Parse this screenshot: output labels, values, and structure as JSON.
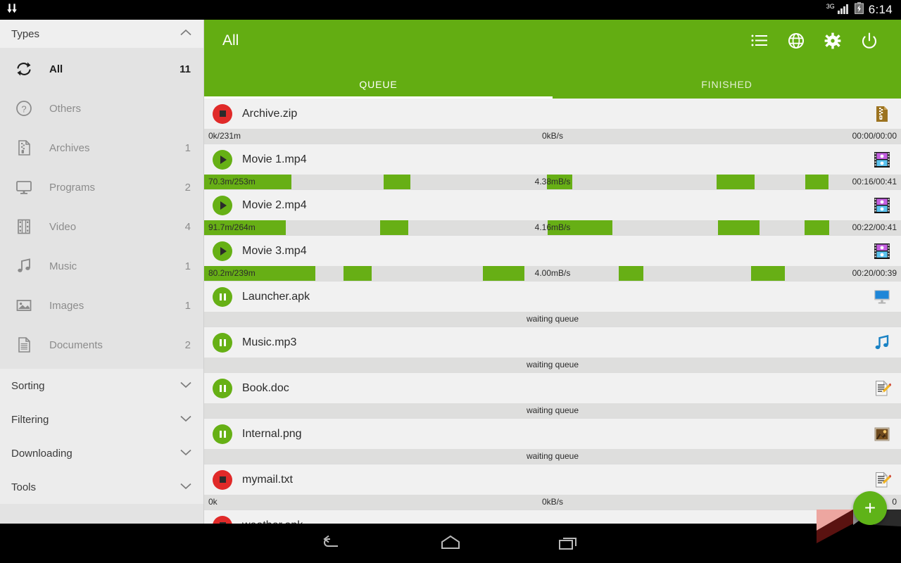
{
  "statusbar": {
    "download_icon": "download-arrows-icon",
    "network": "3G",
    "signal_icon": "signal-bars-icon",
    "battery_icon": "battery-charging-icon",
    "time": "6:14"
  },
  "sidebar": {
    "types_header": {
      "label": "Types",
      "chevron": "chevron-up-icon"
    },
    "types": [
      {
        "icon": "sync-all-icon",
        "label": "All",
        "count": "11",
        "active": true
      },
      {
        "icon": "question-mark-icon",
        "label": "Others",
        "count": "",
        "active": false
      },
      {
        "icon": "archive-file-icon",
        "label": "Archives",
        "count": "1",
        "active": false
      },
      {
        "icon": "monitor-icon",
        "label": "Programs",
        "count": "2",
        "active": false
      },
      {
        "icon": "film-strip-icon",
        "label": "Video",
        "count": "4",
        "active": false
      },
      {
        "icon": "music-note-icon",
        "label": "Music",
        "count": "1",
        "active": false
      },
      {
        "icon": "image-icon",
        "label": "Images",
        "count": "1",
        "active": false
      },
      {
        "icon": "document-icon",
        "label": "Documents",
        "count": "2",
        "active": false
      }
    ],
    "sections": [
      {
        "label": "Sorting",
        "chevron": "chevron-down-icon"
      },
      {
        "label": "Filtering",
        "chevron": "chevron-down-icon"
      },
      {
        "label": "Downloading",
        "chevron": "chevron-down-icon"
      },
      {
        "label": "Tools",
        "chevron": "chevron-down-icon"
      }
    ]
  },
  "appbar": {
    "title": "All",
    "accent_color": "#63ad12",
    "actions": [
      {
        "icon": "list-view-icon"
      },
      {
        "icon": "globe-icon"
      },
      {
        "icon": "gear-icon"
      },
      {
        "icon": "power-icon"
      }
    ],
    "tabs": [
      {
        "label": "QUEUE",
        "active": true
      },
      {
        "label": "FINISHED",
        "active": false
      }
    ]
  },
  "downloads": [
    {
      "name": "Archive.zip",
      "state": "stop",
      "control_icon": "stop-icon",
      "file_icon": "zip-file-icon",
      "progress_left": "0k/231m",
      "progress_mid": "0kB/s",
      "progress_right": "00:00/00:00",
      "segments": []
    },
    {
      "name": "Movie 1.mp4",
      "state": "play",
      "control_icon": "play-icon",
      "file_icon": "video-file-icon",
      "progress_left": "70.3m/253m",
      "progress_mid": "4.38mB/s",
      "progress_right": "00:16/00:41",
      "segments": [
        {
          "left": 0.0,
          "width": 0.125
        },
        {
          "left": 0.258,
          "width": 0.038
        },
        {
          "left": 0.492,
          "width": 0.036
        },
        {
          "left": 0.735,
          "width": 0.055
        },
        {
          "left": 0.863,
          "width": 0.033
        }
      ]
    },
    {
      "name": "Movie 2.mp4",
      "state": "play",
      "control_icon": "play-icon",
      "file_icon": "video-file-icon",
      "progress_left": "91.7m/264m",
      "progress_mid": "4.16mB/s",
      "progress_right": "00:22/00:41",
      "segments": [
        {
          "left": 0.0,
          "width": 0.117
        },
        {
          "left": 0.253,
          "width": 0.04
        },
        {
          "left": 0.493,
          "width": 0.093
        },
        {
          "left": 0.737,
          "width": 0.06
        },
        {
          "left": 0.862,
          "width": 0.035
        }
      ]
    },
    {
      "name": "Movie 3.mp4",
      "state": "play",
      "control_icon": "play-icon",
      "file_icon": "video-file-icon",
      "progress_left": "80.2m/239m",
      "progress_mid": "4.00mB/s",
      "progress_right": "00:20/00:39",
      "segments": [
        {
          "left": 0.0,
          "width": 0.16
        },
        {
          "left": 0.2,
          "width": 0.04
        },
        {
          "left": 0.4,
          "width": 0.06
        },
        {
          "left": 0.595,
          "width": 0.035
        },
        {
          "left": 0.785,
          "width": 0.048
        }
      ]
    },
    {
      "name": "Launcher.apk",
      "state": "pause",
      "control_icon": "pause-icon",
      "file_icon": "program-file-icon",
      "progress_left": "",
      "progress_mid": "waiting queue",
      "progress_right": "",
      "segments": []
    },
    {
      "name": "Music.mp3",
      "state": "pause",
      "control_icon": "pause-icon",
      "file_icon": "music-file-icon",
      "progress_left": "",
      "progress_mid": "waiting queue",
      "progress_right": "",
      "segments": []
    },
    {
      "name": "Book.doc",
      "state": "pause",
      "control_icon": "pause-icon",
      "file_icon": "document-file-icon",
      "progress_left": "",
      "progress_mid": "waiting queue",
      "progress_right": "",
      "segments": []
    },
    {
      "name": "Internal.png",
      "state": "pause",
      "control_icon": "pause-icon",
      "file_icon": "image-file-icon",
      "progress_left": "",
      "progress_mid": "waiting queue",
      "progress_right": "",
      "segments": []
    },
    {
      "name": "mymail.txt",
      "state": "stop",
      "control_icon": "stop-icon",
      "file_icon": "document-file-icon",
      "progress_left": "0k",
      "progress_mid": "0kB/s",
      "progress_right": "0",
      "segments": []
    },
    {
      "name": "weather.apk",
      "state": "stop",
      "control_icon": "stop-icon",
      "file_icon": "program-file-icon",
      "progress_left": "",
      "progress_mid": "",
      "progress_right": "",
      "segments": []
    }
  ],
  "fab": {
    "icon": "plus-icon",
    "label": "+"
  },
  "navbar": [
    {
      "icon": "back-icon"
    },
    {
      "icon": "home-icon"
    },
    {
      "icon": "recents-icon"
    }
  ]
}
